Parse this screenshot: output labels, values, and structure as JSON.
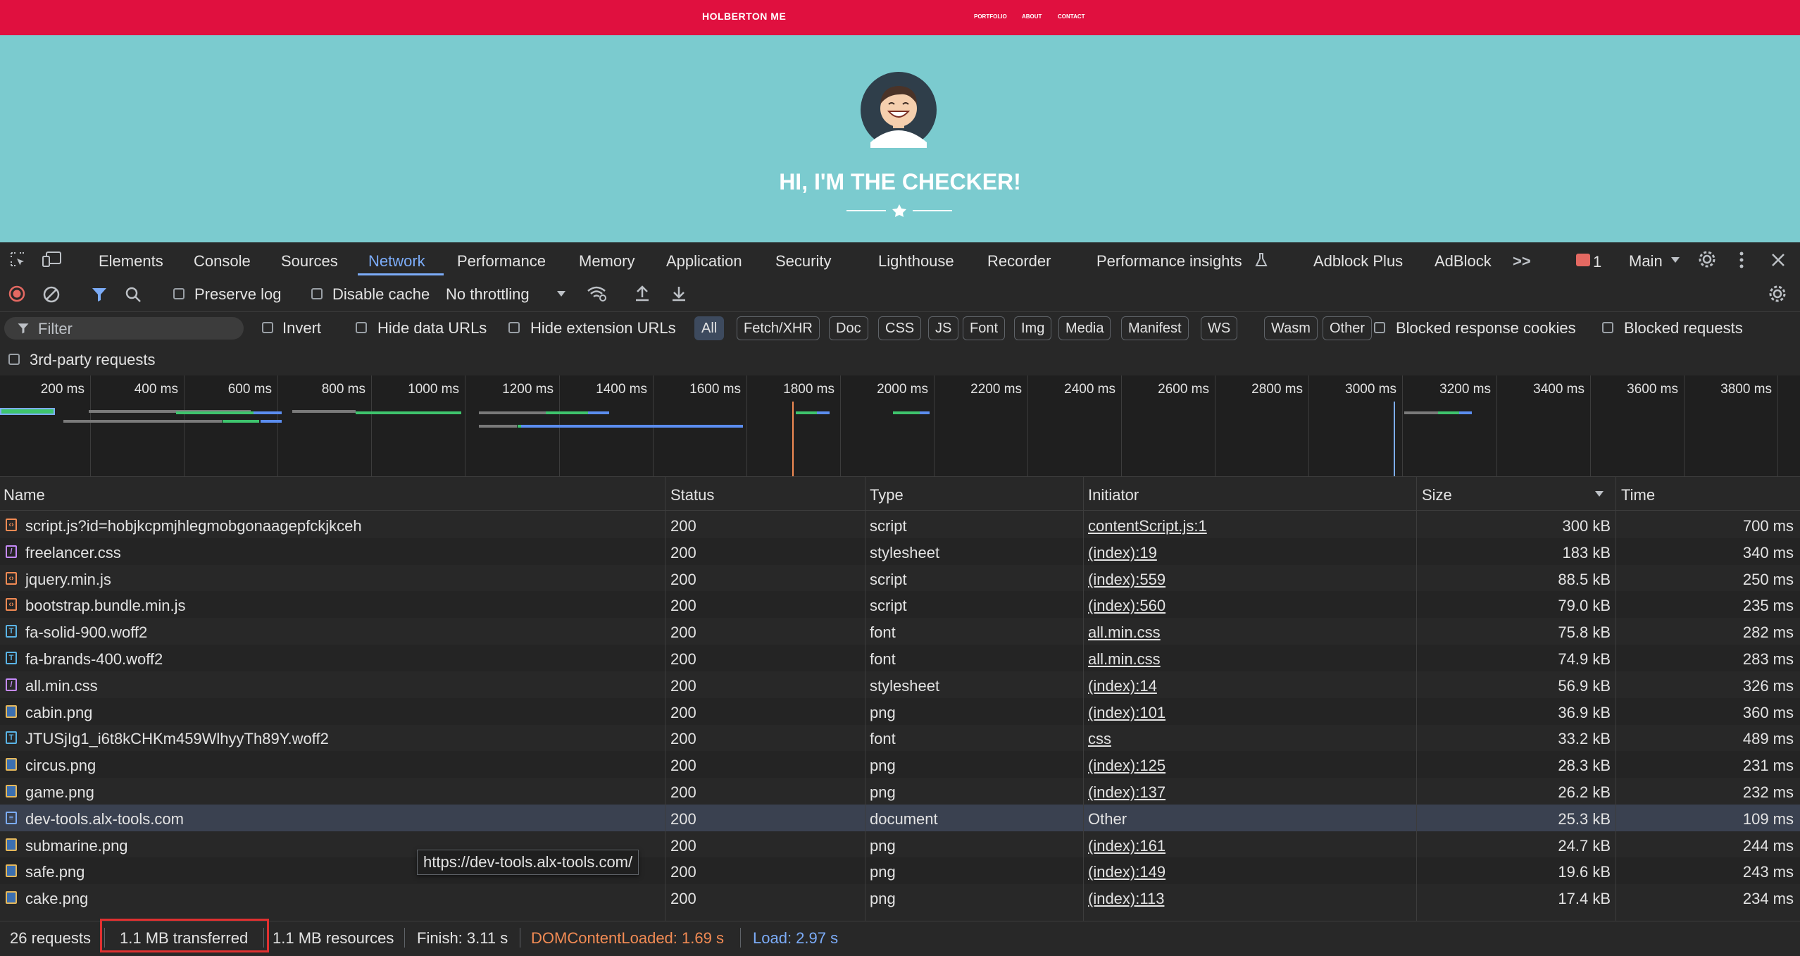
{
  "site": {
    "brand": "HOLBERTON ME",
    "nav": [
      "PORTFOLIO",
      "ABOUT",
      "CONTACT"
    ],
    "hero_title": "HI, I'M THE CHECKER!"
  },
  "devtools": {
    "tabs": [
      "Elements",
      "Console",
      "Sources",
      "Network",
      "Performance",
      "Memory",
      "Application",
      "Security",
      "Lighthouse",
      "Recorder",
      "Performance insights",
      "Adblock Plus",
      "AdBlock"
    ],
    "active_tab": "Network",
    "more_tabs": ">>",
    "error_count": "1",
    "context": "Main",
    "toolbar": {
      "preserve_log": "Preserve log",
      "disable_cache": "Disable cache",
      "throttling": "No throttling"
    },
    "filter": {
      "placeholder": "Filter",
      "invert": "Invert",
      "hide_data_urls": "Hide data URLs",
      "hide_extension_urls": "Hide extension URLs",
      "types": [
        "All",
        "Fetch/XHR",
        "Doc",
        "CSS",
        "JS",
        "Font",
        "Img",
        "Media",
        "Manifest",
        "WS",
        "Wasm",
        "Other"
      ],
      "active_type": "All",
      "blocked_response_cookies": "Blocked response cookies",
      "blocked_requests": "Blocked requests",
      "third_party": "3rd-party requests"
    },
    "timeline_ticks": [
      "200 ms",
      "400 ms",
      "600 ms",
      "800 ms",
      "1000 ms",
      "1200 ms",
      "1400 ms",
      "1600 ms",
      "1800 ms",
      "2000 ms",
      "2200 ms",
      "2400 ms",
      "2600 ms",
      "2800 ms",
      "3000 ms",
      "3200 ms",
      "3400 ms",
      "3600 ms",
      "3800 ms"
    ],
    "columns": {
      "name": "Name",
      "status": "Status",
      "type": "Type",
      "initiator": "Initiator",
      "size": "Size",
      "time": "Time"
    },
    "rows": [
      {
        "name": "script.js?id=hobjkcpmjhlegmobgonaagepfckjkceh",
        "status": "200",
        "type": "script",
        "initiator": "contentScript.js:1",
        "size": "300 kB",
        "time": "700 ms",
        "kind": "script"
      },
      {
        "name": "freelancer.css",
        "status": "200",
        "type": "stylesheet",
        "initiator": "(index):19",
        "size": "183 kB",
        "time": "340 ms",
        "kind": "css"
      },
      {
        "name": "jquery.min.js",
        "status": "200",
        "type": "script",
        "initiator": "(index):559",
        "size": "88.5 kB",
        "time": "250 ms",
        "kind": "script"
      },
      {
        "name": "bootstrap.bundle.min.js",
        "status": "200",
        "type": "script",
        "initiator": "(index):560",
        "size": "79.0 kB",
        "time": "235 ms",
        "kind": "script"
      },
      {
        "name": "fa-solid-900.woff2",
        "status": "200",
        "type": "font",
        "initiator": "all.min.css",
        "size": "75.8 kB",
        "time": "282 ms",
        "kind": "font"
      },
      {
        "name": "fa-brands-400.woff2",
        "status": "200",
        "type": "font",
        "initiator": "all.min.css",
        "size": "74.9 kB",
        "time": "283 ms",
        "kind": "font"
      },
      {
        "name": "all.min.css",
        "status": "200",
        "type": "stylesheet",
        "initiator": "(index):14",
        "size": "56.9 kB",
        "time": "326 ms",
        "kind": "css"
      },
      {
        "name": "cabin.png",
        "status": "200",
        "type": "png",
        "initiator": "(index):101",
        "size": "36.9 kB",
        "time": "360 ms",
        "kind": "img"
      },
      {
        "name": "JTUSjIg1_i6t8kCHKm459WlhyyTh89Y.woff2",
        "status": "200",
        "type": "font",
        "initiator": "css",
        "size": "33.2 kB",
        "time": "489 ms",
        "kind": "font"
      },
      {
        "name": "circus.png",
        "status": "200",
        "type": "png",
        "initiator": "(index):125",
        "size": "28.3 kB",
        "time": "231 ms",
        "kind": "img"
      },
      {
        "name": "game.png",
        "status": "200",
        "type": "png",
        "initiator": "(index):137",
        "size": "26.2 kB",
        "time": "232 ms",
        "kind": "img"
      },
      {
        "name": "dev-tools.alx-tools.com",
        "status": "200",
        "type": "document",
        "initiator": "Other",
        "size": "25.3 kB",
        "time": "109 ms",
        "kind": "doc"
      },
      {
        "name": "submarine.png",
        "status": "200",
        "type": "png",
        "initiator": "(index):161",
        "size": "24.7 kB",
        "time": "244 ms",
        "kind": "img"
      },
      {
        "name": "safe.png",
        "status": "200",
        "type": "png",
        "initiator": "(index):149",
        "size": "19.6 kB",
        "time": "243 ms",
        "kind": "img"
      },
      {
        "name": "cake.png",
        "status": "200",
        "type": "png",
        "initiator": "(index):113",
        "size": "17.4 kB",
        "time": "234 ms",
        "kind": "img"
      }
    ],
    "tooltip": "https://dev-tools.alx-tools.com/",
    "status_bar": {
      "requests": "26 requests",
      "transferred": "1.1 MB transferred",
      "resources": "1.1 MB resources",
      "finish": "Finish: 3.11 s",
      "dom_content_loaded": "DOMContentLoaded: 1.69 s",
      "load": "Load: 2.97 s"
    },
    "colors": {
      "accent": "#7cacf8",
      "dcl": "#f28b54",
      "load": "#7cacf8",
      "site_nav": "#e0103f",
      "hero": "#7bcbcf"
    }
  }
}
